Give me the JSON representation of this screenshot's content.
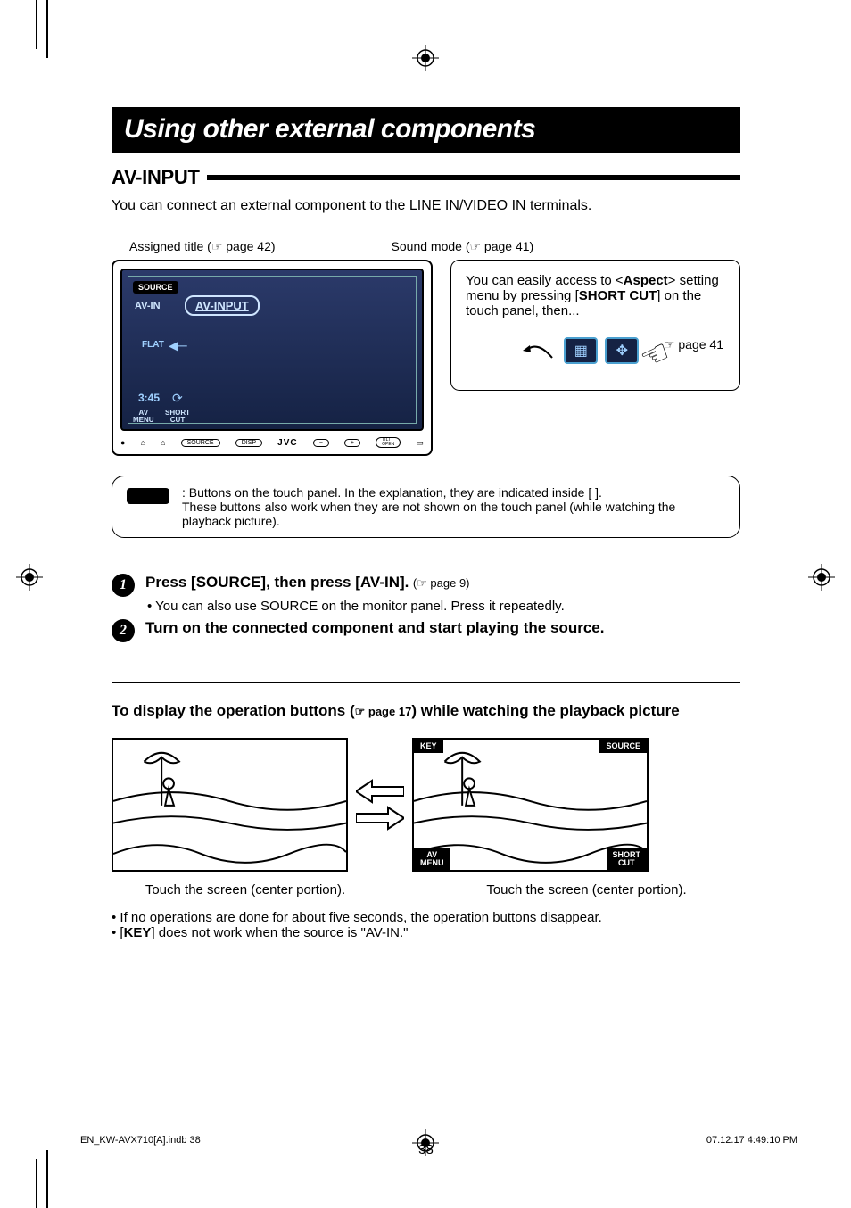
{
  "title": "Using other external components",
  "section": "AV-INPUT",
  "intro": "You can connect an external component to the LINE IN/VIDEO IN terminals.",
  "captions": {
    "assigned_title": "Assigned title (☞ page 42)",
    "sound_mode": "Sound mode (☞ page 41)"
  },
  "device": {
    "source_btn": "SOURCE",
    "avin_label": "AV-IN",
    "avin_box": "AV-INPUT",
    "flat": "FLAT",
    "time": "3:45",
    "av_menu": "AV\nMENU",
    "short_cut": "SHORT\nCUT",
    "brand": "JVC",
    "ctrl_source": "SOURCE",
    "ctrl_disp": "DISP",
    "ctrl_open": "TILT\nOPEN"
  },
  "sidebox": {
    "line1_a": "You can easily access to <",
    "line1_b": "Aspect",
    "line1_c": "> setting menu by pressing [",
    "line1_d": "SHORT CUT",
    "line1_e": "] on the touch panel, then...",
    "pageref": "☞ page 41"
  },
  "note": {
    "l1": "Buttons on the touch panel. In the explanation, they are indicated inside [        ].",
    "l2": "These buttons also work when they are not shown on the touch panel (while watching the playback picture)."
  },
  "steps": {
    "s1_title": "Press [SOURCE], then press [AV-IN].",
    "s1_ref": "(☞ page 9)",
    "s1_sub": "You can also use SOURCE on the monitor panel. Press it repeatedly.",
    "s2_title": "Turn on the connected component and start playing the source."
  },
  "subhead_a": "To display the operation buttons (",
  "subhead_ref": "☞ page 17",
  "subhead_b": ") while watching the playback picture",
  "overlay": {
    "key": "KEY",
    "source": "SOURCE",
    "av_menu": "AV\nMENU",
    "short_cut": "SHORT\nCUT"
  },
  "dual_captions": {
    "left": "Touch the screen (center portion).",
    "right": "Touch the screen (center portion)."
  },
  "bullets": {
    "b1": "If no operations are done for about five seconds, the operation buttons disappear.",
    "b2_a": "[",
    "b2_b": "KEY",
    "b2_c": "] does not work when the source is \"AV-IN.\""
  },
  "page_number": "38",
  "footer": {
    "left": "EN_KW-AVX710[A].indb   38",
    "right": "07.12.17   4:49:10 PM"
  }
}
